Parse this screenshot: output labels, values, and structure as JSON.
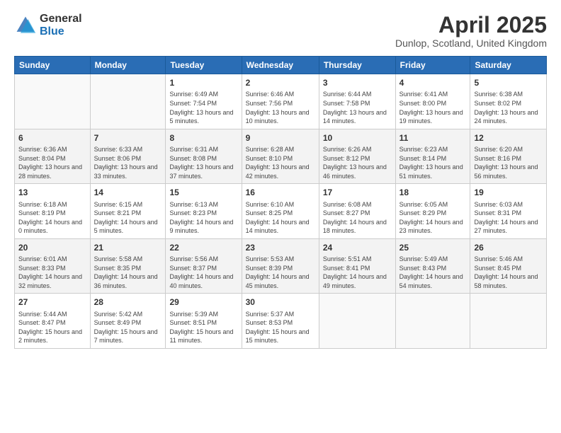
{
  "logo": {
    "general": "General",
    "blue": "Blue"
  },
  "title": {
    "month_year": "April 2025",
    "location": "Dunlop, Scotland, United Kingdom"
  },
  "weekdays": [
    "Sunday",
    "Monday",
    "Tuesday",
    "Wednesday",
    "Thursday",
    "Friday",
    "Saturday"
  ],
  "weeks": [
    [
      {
        "day": "",
        "info": ""
      },
      {
        "day": "",
        "info": ""
      },
      {
        "day": "1",
        "info": "Sunrise: 6:49 AM\nSunset: 7:54 PM\nDaylight: 13 hours and 5 minutes."
      },
      {
        "day": "2",
        "info": "Sunrise: 6:46 AM\nSunset: 7:56 PM\nDaylight: 13 hours and 10 minutes."
      },
      {
        "day": "3",
        "info": "Sunrise: 6:44 AM\nSunset: 7:58 PM\nDaylight: 13 hours and 14 minutes."
      },
      {
        "day": "4",
        "info": "Sunrise: 6:41 AM\nSunset: 8:00 PM\nDaylight: 13 hours and 19 minutes."
      },
      {
        "day": "5",
        "info": "Sunrise: 6:38 AM\nSunset: 8:02 PM\nDaylight: 13 hours and 24 minutes."
      }
    ],
    [
      {
        "day": "6",
        "info": "Sunrise: 6:36 AM\nSunset: 8:04 PM\nDaylight: 13 hours and 28 minutes."
      },
      {
        "day": "7",
        "info": "Sunrise: 6:33 AM\nSunset: 8:06 PM\nDaylight: 13 hours and 33 minutes."
      },
      {
        "day": "8",
        "info": "Sunrise: 6:31 AM\nSunset: 8:08 PM\nDaylight: 13 hours and 37 minutes."
      },
      {
        "day": "9",
        "info": "Sunrise: 6:28 AM\nSunset: 8:10 PM\nDaylight: 13 hours and 42 minutes."
      },
      {
        "day": "10",
        "info": "Sunrise: 6:26 AM\nSunset: 8:12 PM\nDaylight: 13 hours and 46 minutes."
      },
      {
        "day": "11",
        "info": "Sunrise: 6:23 AM\nSunset: 8:14 PM\nDaylight: 13 hours and 51 minutes."
      },
      {
        "day": "12",
        "info": "Sunrise: 6:20 AM\nSunset: 8:16 PM\nDaylight: 13 hours and 56 minutes."
      }
    ],
    [
      {
        "day": "13",
        "info": "Sunrise: 6:18 AM\nSunset: 8:19 PM\nDaylight: 14 hours and 0 minutes."
      },
      {
        "day": "14",
        "info": "Sunrise: 6:15 AM\nSunset: 8:21 PM\nDaylight: 14 hours and 5 minutes."
      },
      {
        "day": "15",
        "info": "Sunrise: 6:13 AM\nSunset: 8:23 PM\nDaylight: 14 hours and 9 minutes."
      },
      {
        "day": "16",
        "info": "Sunrise: 6:10 AM\nSunset: 8:25 PM\nDaylight: 14 hours and 14 minutes."
      },
      {
        "day": "17",
        "info": "Sunrise: 6:08 AM\nSunset: 8:27 PM\nDaylight: 14 hours and 18 minutes."
      },
      {
        "day": "18",
        "info": "Sunrise: 6:05 AM\nSunset: 8:29 PM\nDaylight: 14 hours and 23 minutes."
      },
      {
        "day": "19",
        "info": "Sunrise: 6:03 AM\nSunset: 8:31 PM\nDaylight: 14 hours and 27 minutes."
      }
    ],
    [
      {
        "day": "20",
        "info": "Sunrise: 6:01 AM\nSunset: 8:33 PM\nDaylight: 14 hours and 32 minutes."
      },
      {
        "day": "21",
        "info": "Sunrise: 5:58 AM\nSunset: 8:35 PM\nDaylight: 14 hours and 36 minutes."
      },
      {
        "day": "22",
        "info": "Sunrise: 5:56 AM\nSunset: 8:37 PM\nDaylight: 14 hours and 40 minutes."
      },
      {
        "day": "23",
        "info": "Sunrise: 5:53 AM\nSunset: 8:39 PM\nDaylight: 14 hours and 45 minutes."
      },
      {
        "day": "24",
        "info": "Sunrise: 5:51 AM\nSunset: 8:41 PM\nDaylight: 14 hours and 49 minutes."
      },
      {
        "day": "25",
        "info": "Sunrise: 5:49 AM\nSunset: 8:43 PM\nDaylight: 14 hours and 54 minutes."
      },
      {
        "day": "26",
        "info": "Sunrise: 5:46 AM\nSunset: 8:45 PM\nDaylight: 14 hours and 58 minutes."
      }
    ],
    [
      {
        "day": "27",
        "info": "Sunrise: 5:44 AM\nSunset: 8:47 PM\nDaylight: 15 hours and 2 minutes."
      },
      {
        "day": "28",
        "info": "Sunrise: 5:42 AM\nSunset: 8:49 PM\nDaylight: 15 hours and 7 minutes."
      },
      {
        "day": "29",
        "info": "Sunrise: 5:39 AM\nSunset: 8:51 PM\nDaylight: 15 hours and 11 minutes."
      },
      {
        "day": "30",
        "info": "Sunrise: 5:37 AM\nSunset: 8:53 PM\nDaylight: 15 hours and 15 minutes."
      },
      {
        "day": "",
        "info": ""
      },
      {
        "day": "",
        "info": ""
      },
      {
        "day": "",
        "info": ""
      }
    ]
  ]
}
